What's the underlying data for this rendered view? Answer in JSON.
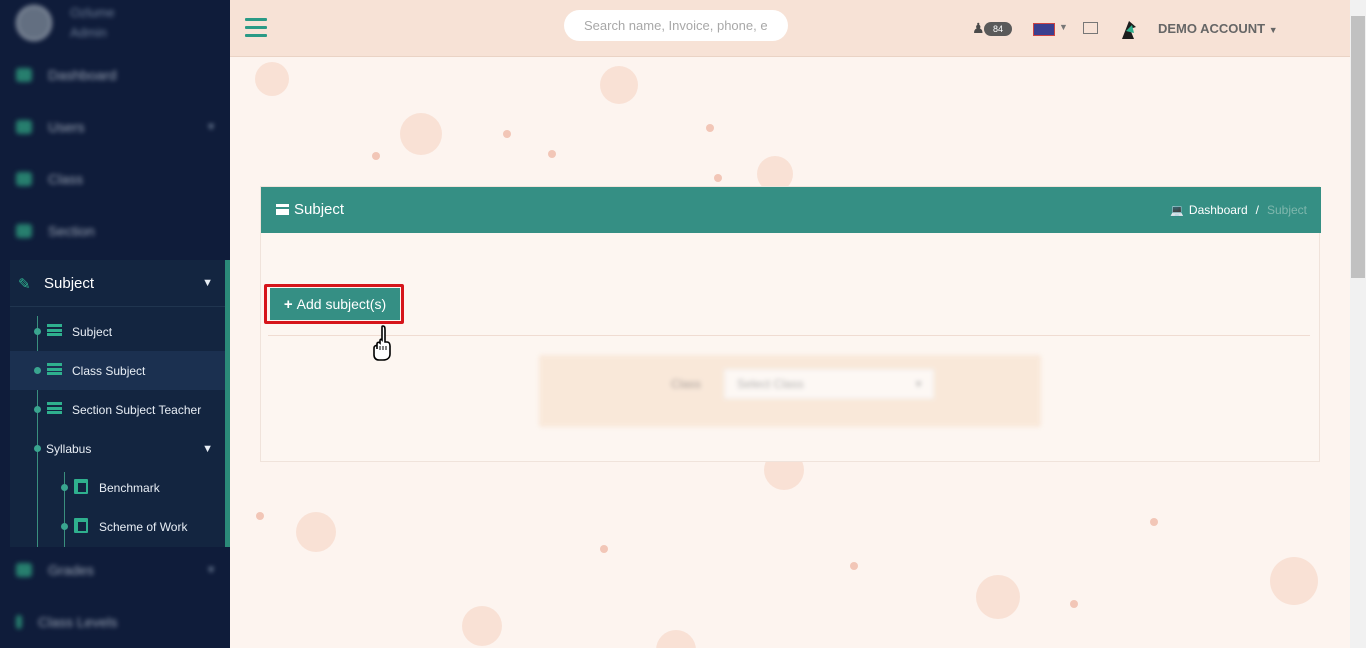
{
  "sidebar": {
    "profile": {
      "name": "Ozlume",
      "role": "Admin"
    },
    "items_top": [
      {
        "label": "Dashboard"
      },
      {
        "label": "Users"
      },
      {
        "label": "Class"
      },
      {
        "label": "Section"
      }
    ],
    "subject_menu": {
      "label": "Subject",
      "items": [
        {
          "label": "Subject"
        },
        {
          "label": "Class Subject"
        },
        {
          "label": "Section Subject Teacher"
        },
        {
          "label": "Syllabus"
        }
      ],
      "syllabus_items": [
        {
          "label": "Benchmark"
        },
        {
          "label": "Scheme of Work"
        }
      ]
    },
    "items_bottom": [
      {
        "label": "Grades"
      },
      {
        "label": "Class Levels"
      }
    ]
  },
  "topbar": {
    "search_placeholder": "Search name, Invoice, phone, e",
    "notification_count": "84",
    "account_label": "DEMO ACCOUNT"
  },
  "card": {
    "title": "Subject",
    "breadcrumb": {
      "home": "Dashboard",
      "separator": "/",
      "current": "Subject"
    },
    "add_button": "Add subject(s)",
    "filter": {
      "label": "Class",
      "placeholder": "Select Class"
    }
  },
  "colors": {
    "sidebar_bg": "#0f1c3a",
    "accent": "#358f84",
    "topbar_bg": "#f7e2d6",
    "highlight": "#d6151b"
  }
}
